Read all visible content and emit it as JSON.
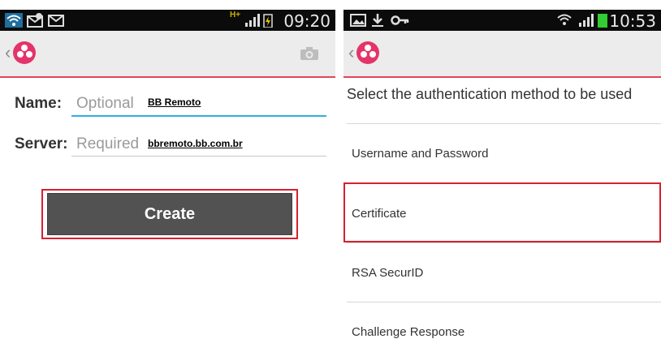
{
  "left": {
    "status_time": "09:20",
    "network_type": "H+",
    "icons": [
      "wifi-icon",
      "sync-icon",
      "mail-icon",
      "signal-icon",
      "battery-icon"
    ],
    "form": {
      "name_label": "Name:",
      "name_placeholder": "Optional",
      "name_value": "BB Remoto",
      "server_label": "Server:",
      "server_placeholder": "Required",
      "server_value": "bbremoto.bb.com.br"
    },
    "create_label": "Create"
  },
  "right": {
    "status_time": "10:53",
    "icons": [
      "image-icon",
      "download-icon",
      "key-icon",
      "wifi-icon",
      "signal-icon",
      "battery-icon"
    ],
    "heading": "Select the authentication method to be used",
    "methods": [
      "Username and Password",
      "Certificate",
      "RSA SecurID",
      "Challenge Response"
    ],
    "selected_method": "Certificate"
  },
  "colors": {
    "accent": "#e0465a",
    "highlight": "#d6202f",
    "input_active": "#33aee0",
    "button": "#525252"
  }
}
